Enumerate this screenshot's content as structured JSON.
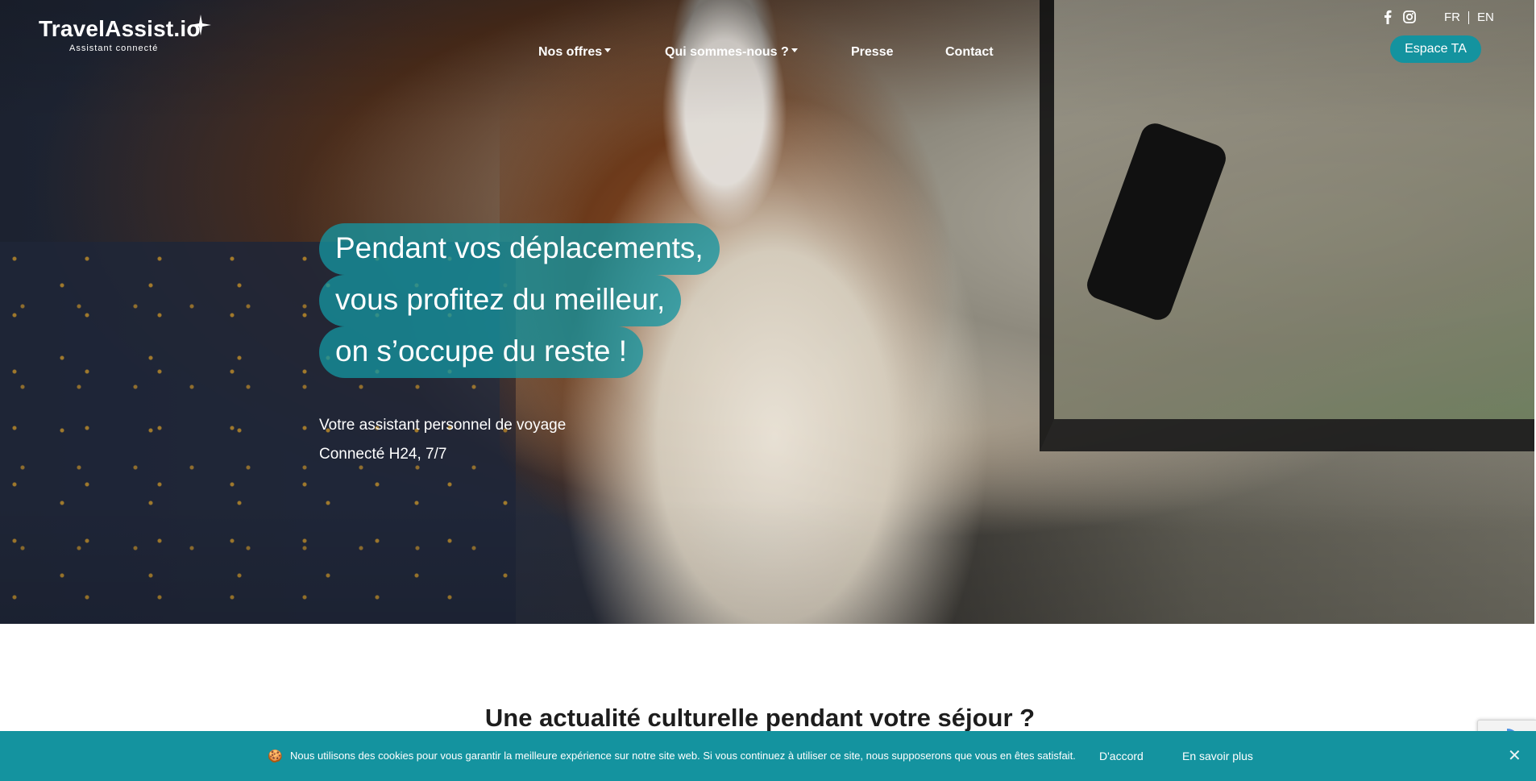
{
  "brand": {
    "name": "TravelAssist.io",
    "tagline": "Assistant connecté"
  },
  "nav": {
    "items": [
      {
        "label": "Nos offres",
        "dropdown": true
      },
      {
        "label": "Qui sommes-nous ?",
        "dropdown": true
      },
      {
        "label": "Presse",
        "dropdown": false
      },
      {
        "label": "Contact",
        "dropdown": false
      }
    ]
  },
  "social": {
    "icons": [
      "facebook-icon",
      "instagram-icon"
    ]
  },
  "lang": {
    "fr": "FR",
    "en": "EN"
  },
  "espace_button": "Espace TA",
  "hero": {
    "headline": [
      "Pendant vos déplacements,",
      "vous profitez du meilleur,",
      "on s’occupe du reste !"
    ],
    "sub_line_1": "Votre assistant personnel de voyage",
    "sub_line_2": "Connecté H24, 7/7"
  },
  "section": {
    "title": "Une actualité culturelle pendant votre séjour ?"
  },
  "cookie": {
    "icon": "🍪",
    "text": "Nous utilisons des cookies pour vous garantir la meilleure expérience sur notre site web. Si vous continuez à utiliser ce site, nous supposerons que vous en êtes satisfait.",
    "accept": "D'accord",
    "more": "En savoir plus",
    "close": "✕"
  },
  "colors": {
    "accent": "#14939f",
    "text_dark": "#1d1d1d",
    "white": "#ffffff"
  }
}
